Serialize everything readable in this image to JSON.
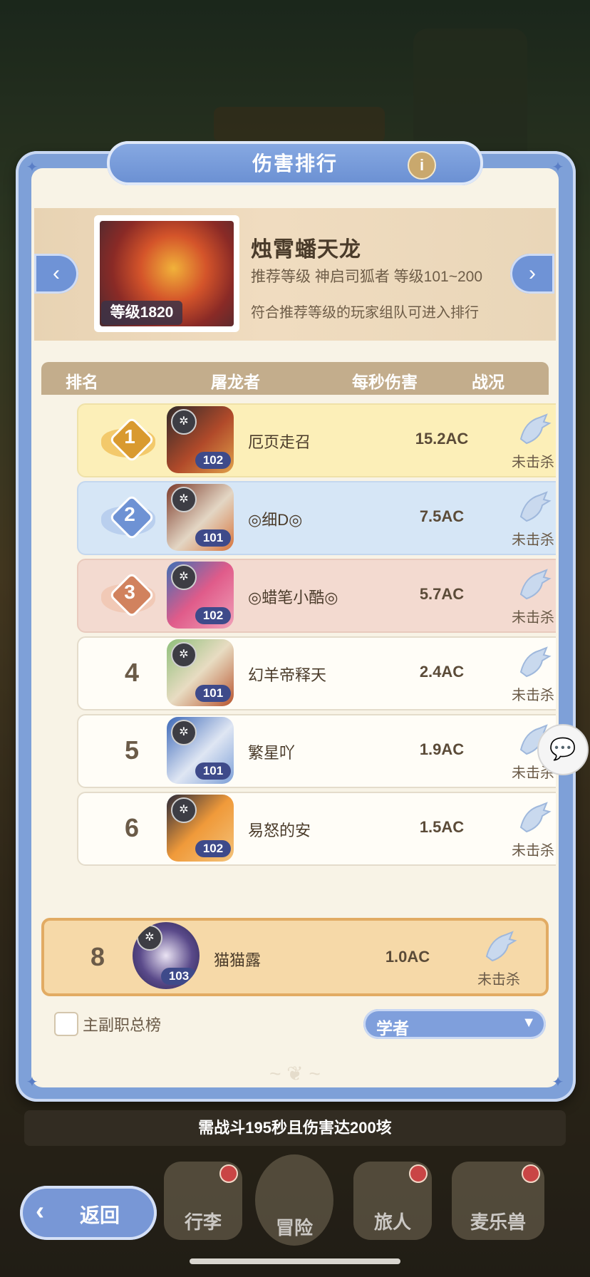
{
  "dialog": {
    "title": "伤害排行",
    "info_icon": "i"
  },
  "boss": {
    "name": "烛霄蟠天龙",
    "level_badge": "等级1820",
    "recommend": "推荐等级  神启司狐者  等级101~200",
    "note": "符合推荐等级的玩家组队可进入排行"
  },
  "table": {
    "headers": [
      "排名",
      "屠龙者",
      "每秒伤害",
      "战况"
    ],
    "rows": [
      {
        "rank": "1",
        "level": "102",
        "name": "厄页走召",
        "dps": "15.2AC",
        "status": "未击杀"
      },
      {
        "rank": "2",
        "level": "101",
        "name": "◎细D◎",
        "dps": "7.5AC",
        "status": "未击杀"
      },
      {
        "rank": "3",
        "level": "102",
        "name": "◎蜡笔小酷◎",
        "dps": "5.7AC",
        "status": "未击杀"
      },
      {
        "rank": "4",
        "level": "101",
        "name": "幻羊帝释天",
        "dps": "2.4AC",
        "status": "未击杀"
      },
      {
        "rank": "5",
        "level": "101",
        "name": "繁星吖",
        "dps": "1.9AC",
        "status": "未击杀"
      },
      {
        "rank": "6",
        "level": "102",
        "name": "易怒的安",
        "dps": "1.5AC",
        "status": "未击杀"
      }
    ],
    "self": {
      "rank": "8",
      "level": "103",
      "name": "猫猫露",
      "dps": "1.0AC",
      "status": "未击杀"
    }
  },
  "controls": {
    "checkbox_label": "主副职总榜",
    "select_value": "学者"
  },
  "requirement": "需战斗195秒且伤害达200垓",
  "nav": {
    "back": "返回",
    "items": [
      "行李",
      "冒险",
      "旅人",
      "麦乐兽"
    ]
  },
  "colors": {
    "accent": "#7897d6",
    "gold": "#e2ab63",
    "panel_bg": "#f8f3e6"
  }
}
